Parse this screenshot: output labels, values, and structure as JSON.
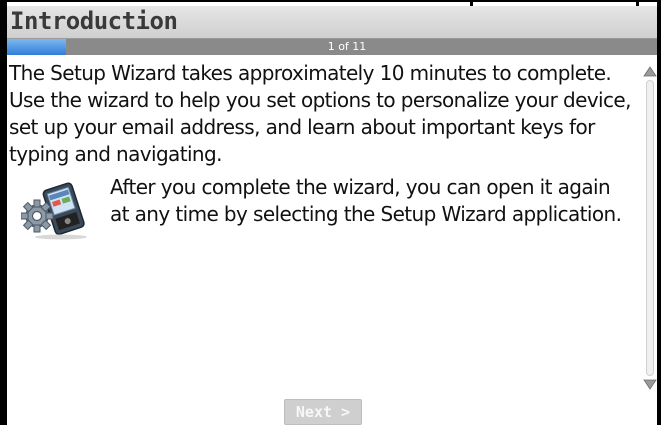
{
  "window": {
    "title": "Introduction"
  },
  "progress": {
    "label": "1 of 11",
    "current": 1,
    "total": 11,
    "fill_fraction": 0.09,
    "fill_color": "#2f7fd8"
  },
  "content": {
    "intro_text": "The Setup Wizard takes approximately 10 minutes to complete. Use the wizard to help you set options to personalize your device, set up your email address, and learn about important keys for typing and navigating.",
    "tip_icon": "setup-wizard-gear-device-icon",
    "tip_text": "After you complete the wizard, you can open it again at any time by selecting the Setup Wizard application."
  },
  "scrollbar": {
    "up_icon": "scroll-up-arrow-icon",
    "down_icon": "scroll-down-arrow-icon"
  },
  "footer": {
    "next_label": "Next >"
  }
}
